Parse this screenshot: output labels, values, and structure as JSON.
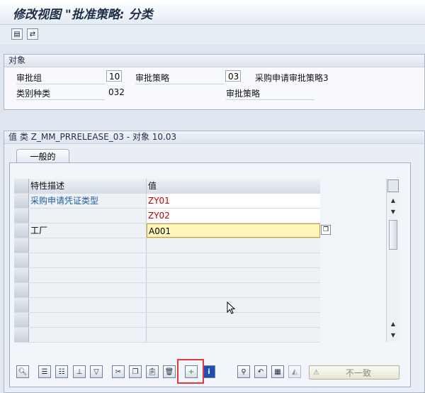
{
  "title": "修改视图 \"批准策略: 分类",
  "toolbar": {
    "icons": [
      "save-icon",
      "other-view-icon"
    ]
  },
  "object_section": {
    "header": "对象",
    "release_group_label": "审批组",
    "release_group_value": "10",
    "release_strategy_label": "审批策略",
    "release_strategy_value": "03",
    "release_strategy_desc": "采购申请审批策略3",
    "class_type_label": "类别种类",
    "class_type_value": "032",
    "release_strategy_label2": "审批策略"
  },
  "values_section": {
    "header": "值 类 Z_MM_PRRELEASE_03 - 对象 10.03",
    "tab_label": "一般的",
    "col_char_desc": "特性描述",
    "col_value": "值",
    "rows": [
      {
        "desc": "采购申请凭证类型",
        "value": "ZY01"
      },
      {
        "desc": "",
        "value": "ZY02"
      },
      {
        "desc": "工厂",
        "value": "A001"
      }
    ]
  },
  "bottom_toolbar": {
    "inconsistent_label": "不一致"
  },
  "colors": {
    "accent_red": "#c00000",
    "link_blue": "#1e5d9b",
    "highlight": "#e53b3b",
    "active_field": "#fff6b8"
  }
}
